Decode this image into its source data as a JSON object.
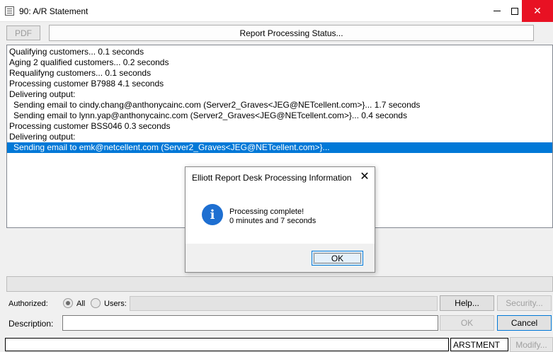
{
  "window": {
    "title": "90: A/R Statement"
  },
  "toolbar": {
    "pdf_label": "PDF",
    "status_label": "Report Processing Status..."
  },
  "log": {
    "lines": [
      {
        "text": "Qualifying customers...  0.1 seconds",
        "indent": false,
        "selected": false
      },
      {
        "text": "Aging 2 qualified customers...  0.2 seconds",
        "indent": false,
        "selected": false
      },
      {
        "text": "Requalifyng customers...  0.1 seconds",
        "indent": false,
        "selected": false
      },
      {
        "text": "Processing customer B7988   4.1 seconds",
        "indent": false,
        "selected": false
      },
      {
        "text": "Delivering output:",
        "indent": false,
        "selected": false
      },
      {
        "text": "Sending email to cindy.chang@anthonycainc.com (Server2_Graves<JEG@NETcellent.com>}...   1.7 seconds",
        "indent": true,
        "selected": false
      },
      {
        "text": "Sending email to lynn.yap@anthonycainc.com (Server2_Graves<JEG@NETcellent.com>}...  0.4 seconds",
        "indent": true,
        "selected": false
      },
      {
        "text": "Processing customer BSS046  0.3 seconds",
        "indent": false,
        "selected": false
      },
      {
        "text": "Delivering output:",
        "indent": false,
        "selected": false
      },
      {
        "text": "Sending email to emk@netcellent.com (Server2_Graves<JEG@NETcellent.com>}...",
        "indent": true,
        "selected": true
      }
    ]
  },
  "form": {
    "authorized_label": "Authorized:",
    "all_label": "All",
    "users_label": "Users:",
    "description_label": "Description:",
    "help_label": "Help...",
    "security_label": "Security...",
    "ok_label": "OK",
    "cancel_label": "Cancel",
    "modify_label": "Modify...",
    "program_name": "ARSTMENT"
  },
  "dialog": {
    "title": "Elliott Report Desk Processing Information",
    "message_line1": "Processing complete!",
    "message_line2": "0 minutes and 7 seconds",
    "ok_label": "OK"
  },
  "icons": {
    "info": "info-icon",
    "close": "close-icon"
  },
  "colors": {
    "selection": "#0078d7",
    "info_icon": "#1e6fd1",
    "close_hover": "#e81123"
  }
}
